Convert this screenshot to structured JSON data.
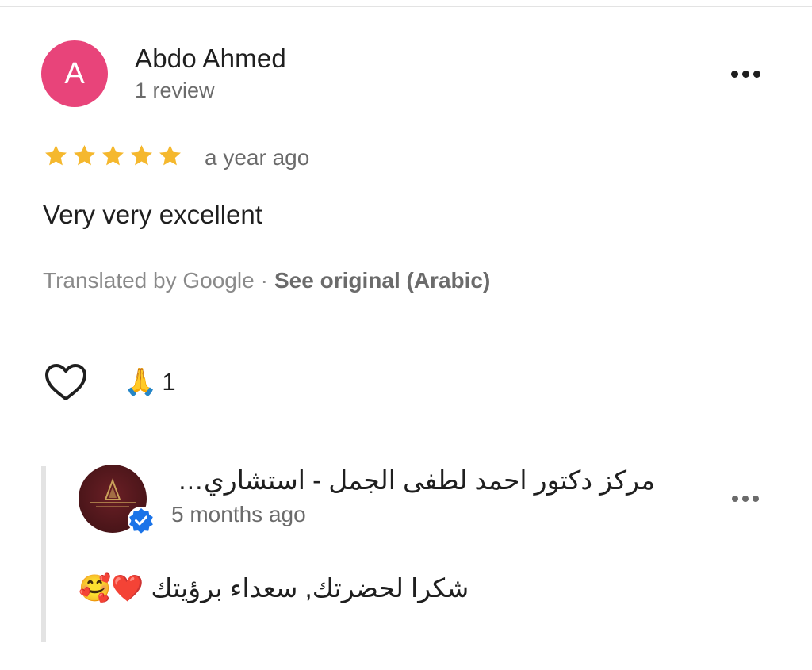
{
  "review": {
    "avatar_letter": "A",
    "avatar_color": "#e8447a",
    "reviewer_name": "Abdo Ahmed",
    "review_count": "1 review",
    "rating": 5,
    "rating_max": 5,
    "star_color": "#f5b82e",
    "time_ago": "a year ago",
    "text": "Very very excellent",
    "translated_label": "Translated by Google",
    "separator": "·",
    "see_original_label": "See original (Arabic)",
    "like_icon": "heart-outline-icon",
    "reaction_emoji": "🙏",
    "reaction_count": "1",
    "more_icon": "more-horizontal-icon"
  },
  "owner_response": {
    "avatar_color": "#4a1519",
    "verified_icon": "verified-badge-icon",
    "verified_color": "#1a73e8",
    "name": "مركز دكتور احمد لطفى الجمل - استشاري جراحة التجميل",
    "time_ago": "5 months ago",
    "text": "شكرا لحضرتك, سعداء برؤيتك ❤️🥰",
    "more_icon": "more-horizontal-icon"
  }
}
